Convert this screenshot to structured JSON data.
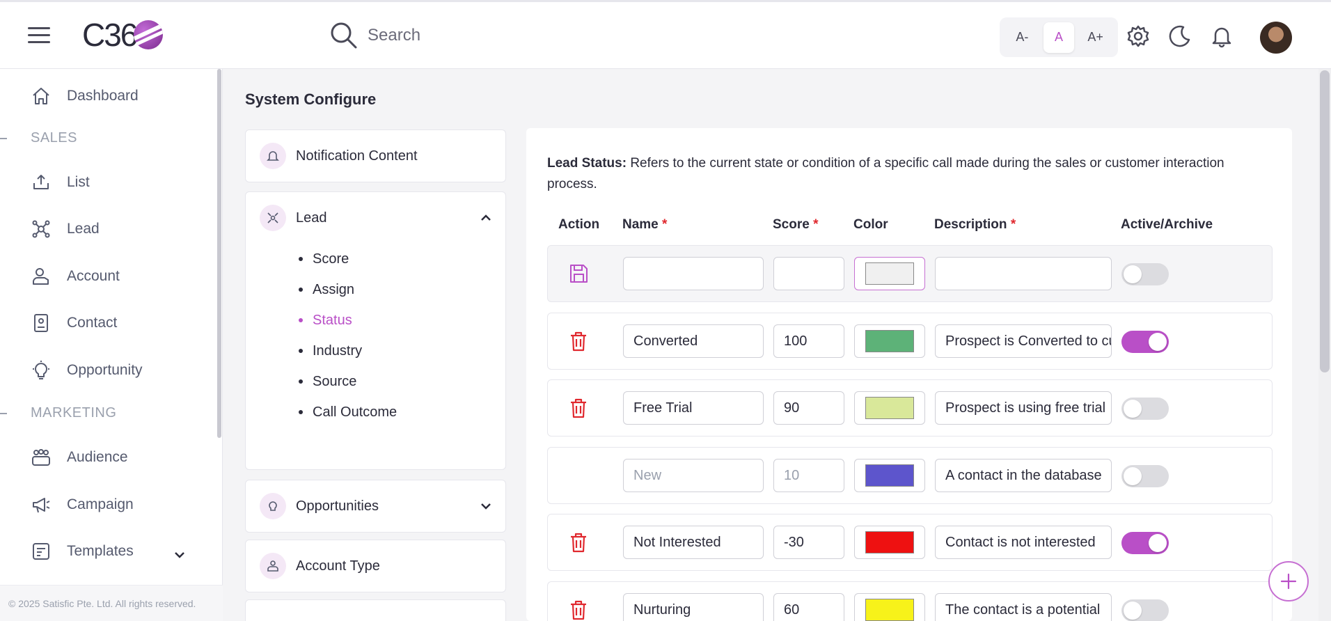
{
  "header": {
    "logo_text": "C36",
    "search_placeholder": "Search",
    "font_sizes": [
      {
        "label": "A-",
        "active": false
      },
      {
        "label": "A",
        "active": true
      },
      {
        "label": "A+",
        "active": false
      }
    ]
  },
  "sidebar": {
    "items": [
      {
        "label": "Dashboard",
        "icon": "home-icon"
      },
      {
        "section": "SALES"
      },
      {
        "label": "List",
        "icon": "upload-icon"
      },
      {
        "label": "Lead",
        "icon": "network-icon"
      },
      {
        "label": "Account",
        "icon": "user-card-icon"
      },
      {
        "label": "Contact",
        "icon": "contact-card-icon"
      },
      {
        "label": "Opportunity",
        "icon": "bulb-icon"
      },
      {
        "section": "MARKETING"
      },
      {
        "label": "Audience",
        "icon": "people-icon"
      },
      {
        "label": "Campaign",
        "icon": "megaphone-icon"
      },
      {
        "label": "Templates",
        "icon": "template-icon"
      }
    ],
    "footer": "© 2025 Satisfic Pte. Ltd. All rights reserved."
  },
  "main": {
    "title": "System Configure",
    "menu": {
      "notification": "Notification Content",
      "lead": "Lead",
      "lead_sub": [
        "Score",
        "Assign",
        "Status",
        "Industry",
        "Source",
        "Call Outcome"
      ],
      "active_sub": "Status",
      "opportunities": "Opportunities",
      "account_type": "Account Type"
    },
    "description_label": "Lead Status:",
    "description_text": "Refers to the current state or condition of a specific call made during the sales or customer interaction process.",
    "columns": {
      "action": "Action",
      "name": "Name",
      "score": "Score",
      "color": "Color",
      "description": "Description",
      "active": "Active/Archive",
      "required_mark": "*"
    },
    "rows": [
      {
        "name": "",
        "score": "",
        "color": "#f0f0f0",
        "description": "",
        "active": false
      },
      {
        "name": "Converted",
        "score": "100",
        "color": "#5db278",
        "description": "Prospect is Converted to customer",
        "active": true
      },
      {
        "name": "Free Trial",
        "score": "90",
        "color": "#d9e89a",
        "description": "Prospect is using free trial",
        "active": false
      },
      {
        "name": "New",
        "score": "10",
        "color": "#5d55cc",
        "description": "A contact in the database",
        "active": false
      },
      {
        "name": "Not Interested",
        "score": "-30",
        "color": "#ee1111",
        "description": "Contact is not interested",
        "active": true
      },
      {
        "name": "Nurturing",
        "score": "60",
        "color": "#f7f21a",
        "description": "The contact is a potential",
        "active": false
      }
    ]
  },
  "colors": {
    "accent": "#b94fc7",
    "delete": "#e0282e"
  }
}
